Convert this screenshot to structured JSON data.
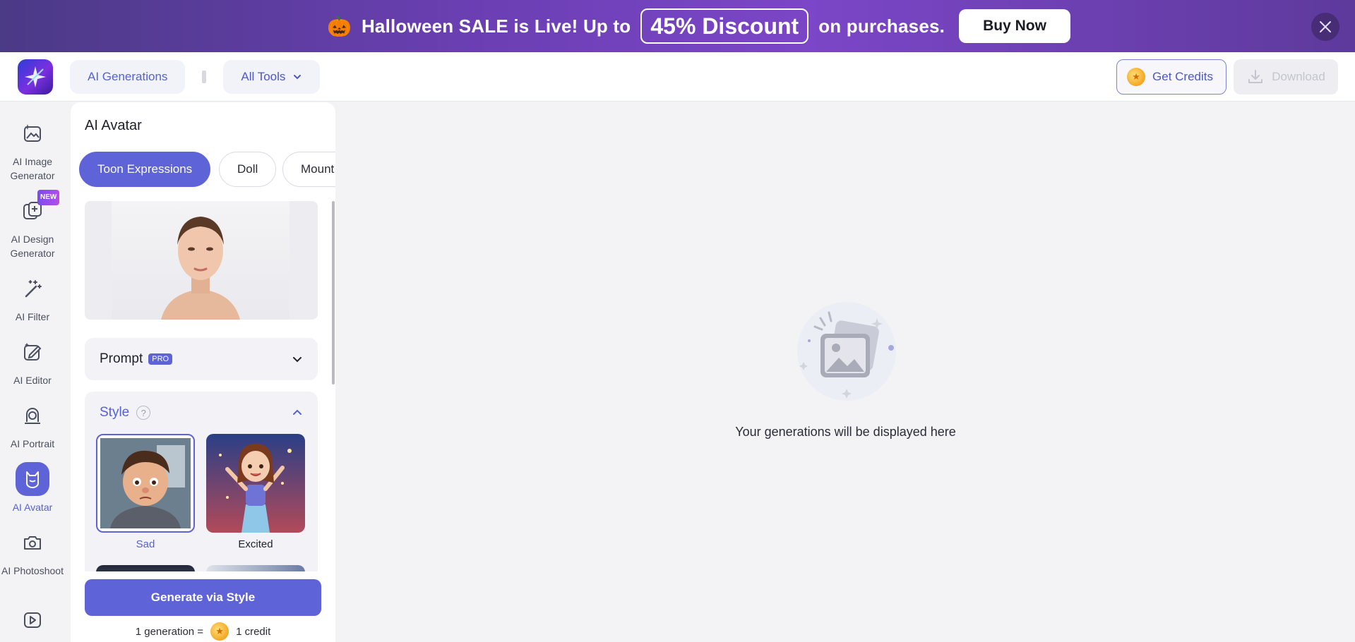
{
  "banner": {
    "emoji": "🎃",
    "text_before": "Halloween SALE is Live! Up to",
    "discount": "45% Discount",
    "text_after": "on purchases.",
    "buy_label": "Buy Now"
  },
  "header": {
    "ai_generations_label": "AI Generations",
    "all_tools_label": "All Tools",
    "get_credits_label": "Get Credits",
    "download_label": "Download"
  },
  "rail": {
    "items": [
      {
        "label": "AI Image Generator",
        "icon": "image-sparkle-icon"
      },
      {
        "label": "AI Design Generator",
        "icon": "design-sparkle-icon",
        "badge": "NEW"
      },
      {
        "label": "AI Filter",
        "icon": "magic-wand-icon"
      },
      {
        "label": "AI Editor",
        "icon": "edit-image-icon"
      },
      {
        "label": "AI Portrait",
        "icon": "portrait-icon"
      },
      {
        "label": "AI Avatar",
        "icon": "avatar-icon",
        "active": true
      },
      {
        "label": "AI Photoshoot",
        "icon": "camera-icon"
      },
      {
        "label": "",
        "icon": "video-icon"
      }
    ]
  },
  "panel": {
    "title": "AI Avatar",
    "chips": [
      "Toon Expressions",
      "Doll",
      "Mount"
    ],
    "prompt_label": "Prompt",
    "prompt_badge": "PRO",
    "style_label": "Style",
    "help_glyph": "?",
    "styles": [
      {
        "label": "Sad",
        "selected": true
      },
      {
        "label": "Excited",
        "selected": false
      }
    ],
    "generate_label": "Generate via Style",
    "note_prefix": "1 generation =",
    "note_suffix": "1 credit"
  },
  "main": {
    "empty_text": "Your generations will be displayed here"
  },
  "colors": {
    "accent": "#5e63d8",
    "banner_start": "#4b3a86",
    "banner_end": "#7b46c7"
  }
}
